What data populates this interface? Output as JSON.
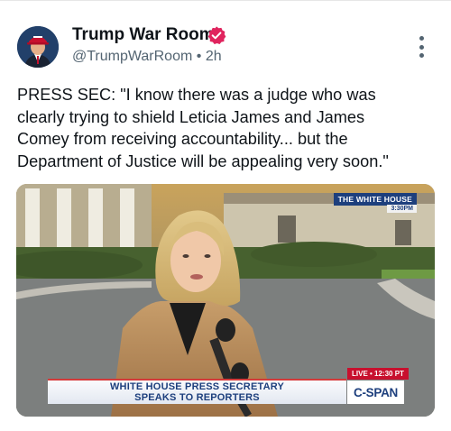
{
  "post": {
    "author_name": "Trump War Room",
    "handle": "@TrumpWarRoom",
    "separator": "•",
    "time": "2h",
    "text": "PRESS SEC: \"I know there was a judge who was clearly trying to shield Leticia James and James Comey from receiving accountability... but the Department of Justice will be appealing very soon.\""
  },
  "media": {
    "channel_bug": "THE WHITE HOUSE",
    "bug_time": "3:30PM",
    "chyron_line1": "WHITE HOUSE PRESS SECRETARY",
    "chyron_line2": "SPEAKS TO REPORTERS",
    "live_label": "LIVE • 12:30 PT",
    "network": "C-SPAN"
  },
  "icons": {
    "verified": "verified-badge-icon",
    "more": "more-options-icon",
    "avatar": "avatar-image"
  },
  "colors": {
    "verified_badge": "#e0245e",
    "text_primary": "#0f1419",
    "text_secondary": "#536471",
    "cspan_blue": "#1d3f7d",
    "live_red": "#c8102e"
  }
}
